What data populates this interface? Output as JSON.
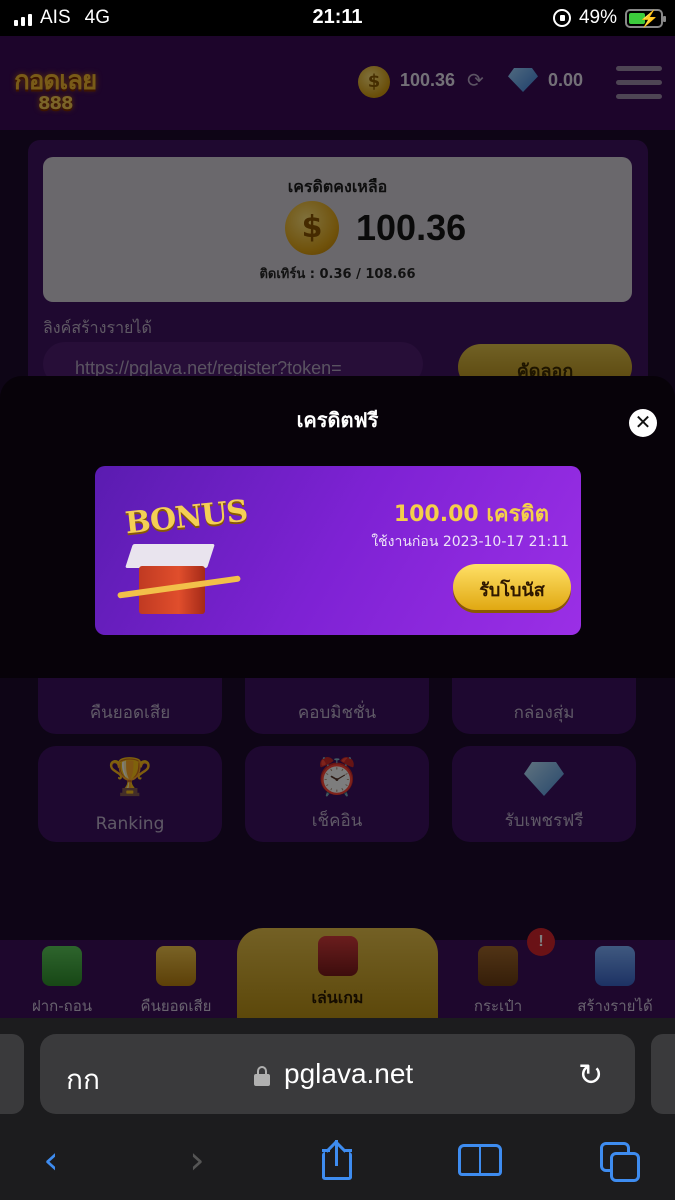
{
  "status_bar": {
    "carrier": "AIS",
    "network": "4G",
    "time": "21:11",
    "battery": "49%"
  },
  "header": {
    "logo_top": "กอดเลย",
    "logo_bottom": "888",
    "coin_balance": "100.36",
    "gem_balance": "0.00"
  },
  "credit_panel": {
    "title": "เครดิตคงเหลือ",
    "amount": "100.36",
    "turnover": "ติดเทิร์น : 0.36 / 108.66",
    "link_label": "ลิงค์สร้างรายได้",
    "link_value": "https://pglava.net/register?token=",
    "copy_label": "คัดลอก"
  },
  "tiles": [
    {
      "label": "คืนยอดเสีย"
    },
    {
      "label": "คอบมิชชั่น"
    },
    {
      "label": "กล่องสุ่ม"
    },
    {
      "label": "Ranking"
    },
    {
      "label": "เช็คอิน"
    },
    {
      "label": "รับเพชรฟรี"
    }
  ],
  "bottom_nav": {
    "items": [
      {
        "label": "ฝาก-ถอน"
      },
      {
        "label": "คืนยอดเสีย"
      },
      {
        "label": "เล่นเกม"
      },
      {
        "label": "กระเป๋า"
      },
      {
        "label": "สร้างรายได้"
      }
    ],
    "badge": "!"
  },
  "modal": {
    "title": "เครดิตฟรี",
    "bonus_word": "BONUS",
    "amount": "100.00 เครดิต",
    "expiry": "ใช้งานก่อน 2023-10-17 21:11",
    "claim_label": "รับโบนัส"
  },
  "browser": {
    "aa_label": "กก",
    "domain": "pglava.net"
  },
  "colors": {
    "accent_gold": "#e0a812",
    "panel_purple": "#3f1260",
    "card_purple": "#7e22d4",
    "ios_blue": "#3e8cf0"
  },
  "icons": [
    "coin-icon",
    "refresh-icon",
    "gem-icon",
    "menu-icon",
    "close-icon",
    "lock-icon",
    "reload-icon",
    "back-icon",
    "forward-icon",
    "share-icon",
    "bookmarks-icon",
    "tabs-icon"
  ]
}
